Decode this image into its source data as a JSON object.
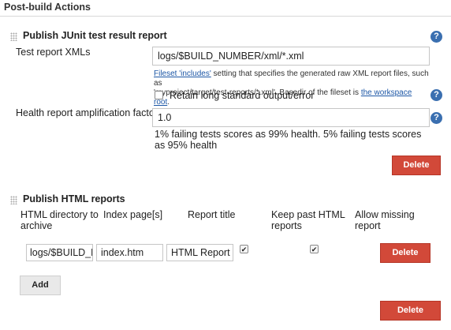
{
  "section": {
    "title": "Post-build Actions"
  },
  "junit": {
    "title": "Publish JUnit test result report",
    "report_xmls_label": "Test report XMLs",
    "report_xmls_value": "logs/$BUILD_NUMBER/xml/*.xml",
    "desc_link1": "Fileset 'includes'",
    "desc_text1": " setting that specifies the generated raw XML report files, such as",
    "desc_text2": "'myproject/target/test-reports/*.xml'. Basedir of the fileset is ",
    "desc_link2": "the workspace root",
    "desc_text3": ".",
    "retain_label": "Retain long standard output/error",
    "retain_checked": false,
    "health_label": "Health report amplification factor",
    "health_value": "1.0",
    "health_hint": "1% failing tests scores as 99% health. 5% failing tests scores as 95% health",
    "delete_label": "Delete"
  },
  "html_reports": {
    "title": "Publish HTML reports",
    "columns": {
      "dir": "HTML directory to archive",
      "index": "Index page[s]",
      "title": "Report title",
      "keep": "Keep past HTML reports",
      "allow": "Allow missing report"
    },
    "row": {
      "dir_value": "logs/$BUILD_N",
      "index_value": "index.htm",
      "title_value": "HTML Report",
      "keep_checked": true,
      "allow_checked": true,
      "delete_label": "Delete"
    },
    "add_label": "Add",
    "delete_label": "Delete"
  },
  "icons": {
    "help": "?"
  }
}
